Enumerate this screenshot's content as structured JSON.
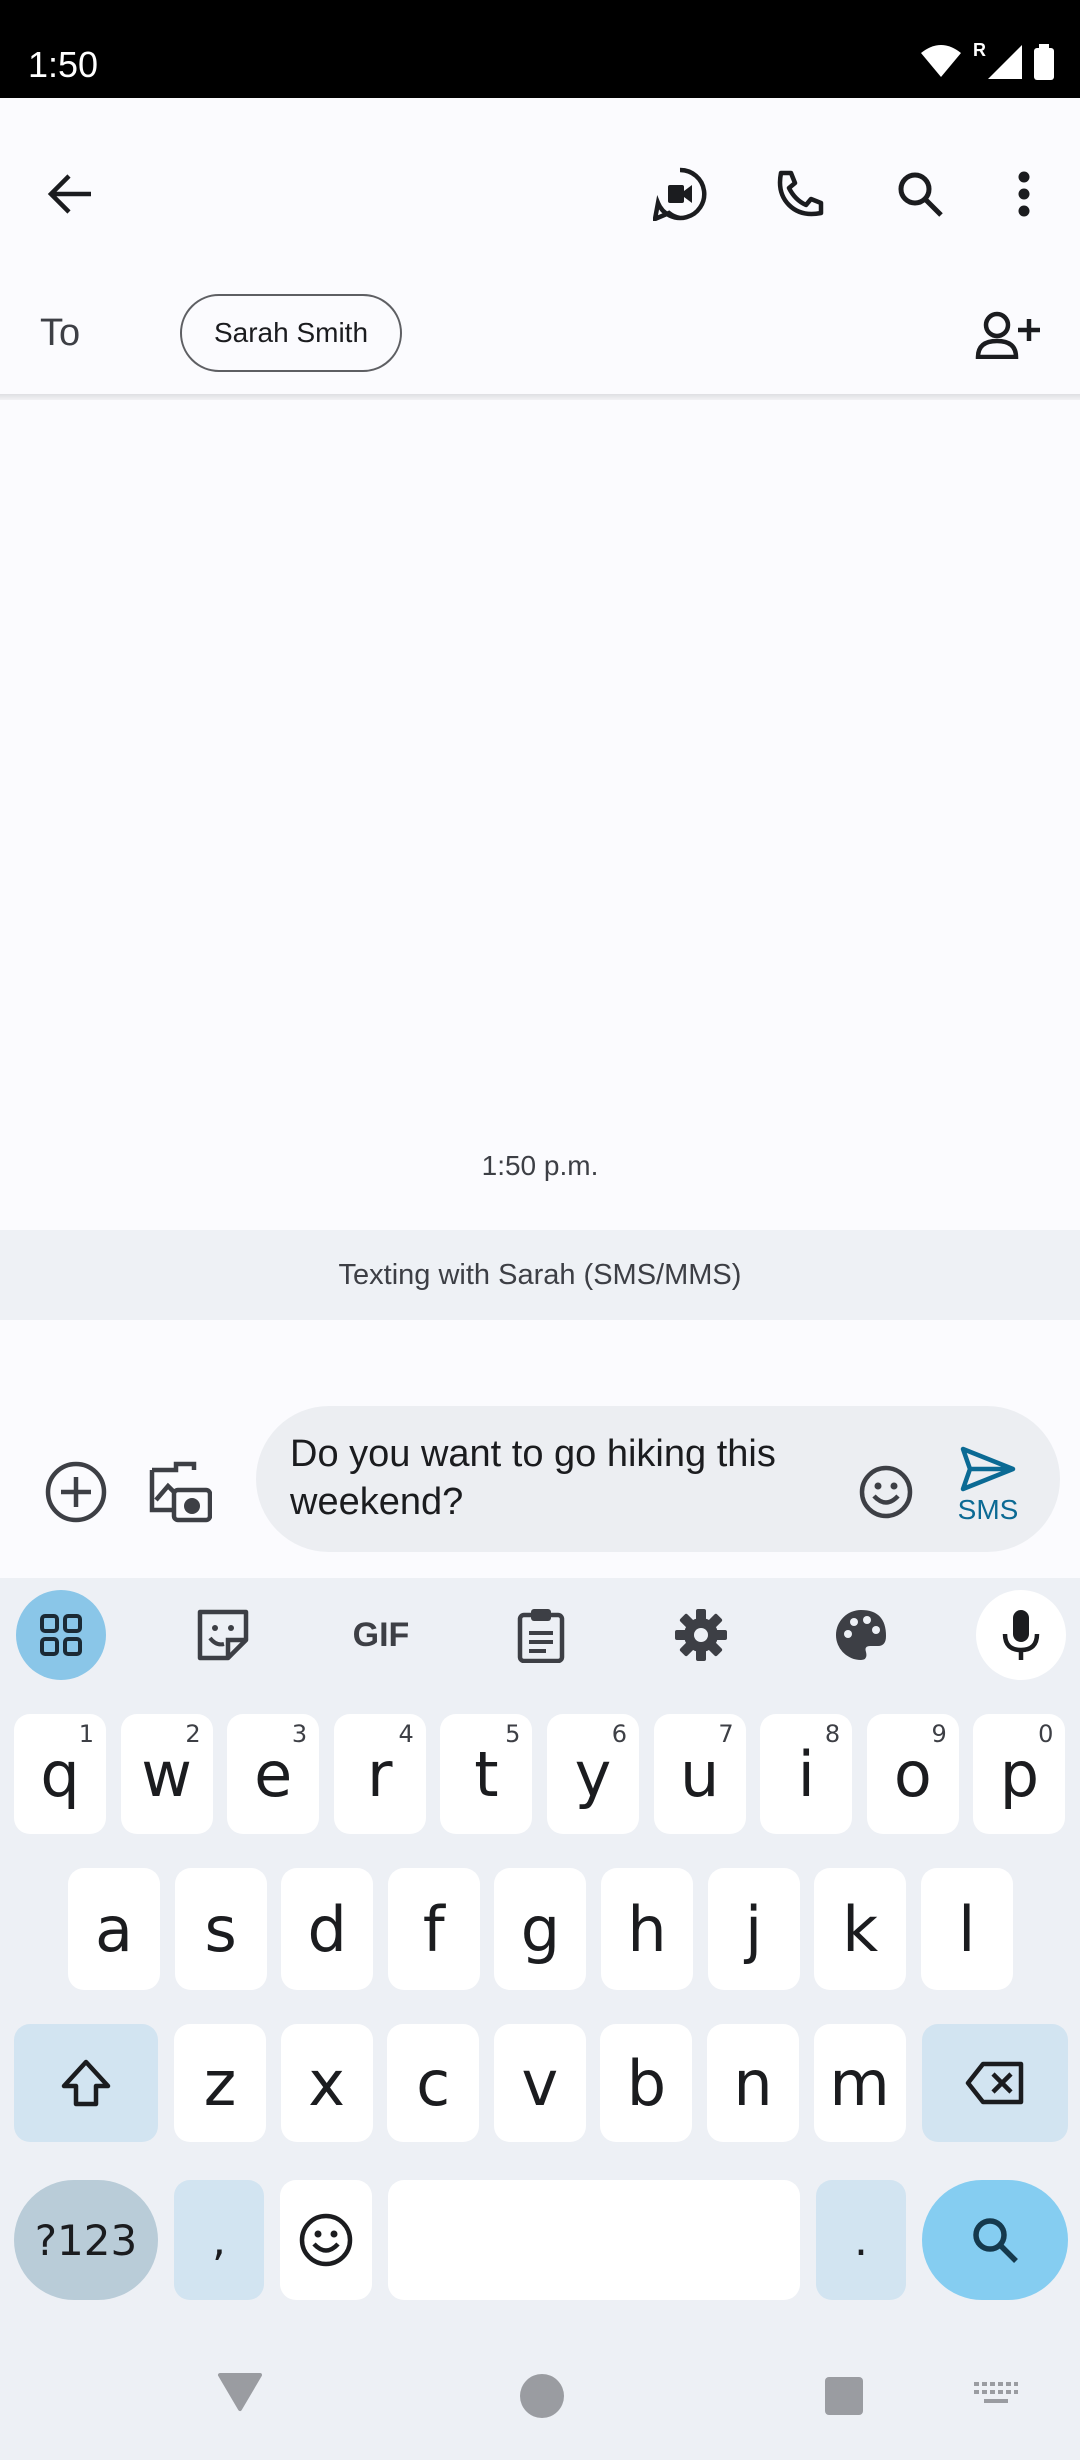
{
  "status_bar": {
    "time": "1:50",
    "roaming_indicator": "R"
  },
  "header": {
    "back_icon": "arrow-left-icon",
    "video_icon": "video-call-icon",
    "phone_icon": "phone-icon",
    "search_icon": "search-icon",
    "more_icon": "more-vert-icon"
  },
  "recipients": {
    "to_label": "To",
    "chip_name": "Sarah Smith",
    "add_icon": "add-person-icon"
  },
  "conversation": {
    "timestamp": "1:50 p.m.",
    "banner": "Texting with Sarah (SMS/MMS)"
  },
  "compose": {
    "text": "Do you want to go hiking this weekend?",
    "send_label": "SMS",
    "accent": "#0b6a94"
  },
  "keyboard": {
    "toolbar": [
      "apps-icon",
      "sticker-icon",
      "GIF",
      "clipboard-icon",
      "settings-icon",
      "palette-icon",
      "mic-icon"
    ],
    "row1": [
      {
        "k": "q",
        "h": "1"
      },
      {
        "k": "w",
        "h": "2"
      },
      {
        "k": "e",
        "h": "3"
      },
      {
        "k": "r",
        "h": "4"
      },
      {
        "k": "t",
        "h": "5"
      },
      {
        "k": "y",
        "h": "6"
      },
      {
        "k": "u",
        "h": "7"
      },
      {
        "k": "i",
        "h": "8"
      },
      {
        "k": "o",
        "h": "9"
      },
      {
        "k": "p",
        "h": "0"
      }
    ],
    "row2": [
      "a",
      "s",
      "d",
      "f",
      "g",
      "h",
      "j",
      "k",
      "l"
    ],
    "row3": [
      "z",
      "x",
      "c",
      "v",
      "b",
      "n",
      "m"
    ],
    "num_label": "?123",
    "comma": ",",
    "period": "."
  }
}
